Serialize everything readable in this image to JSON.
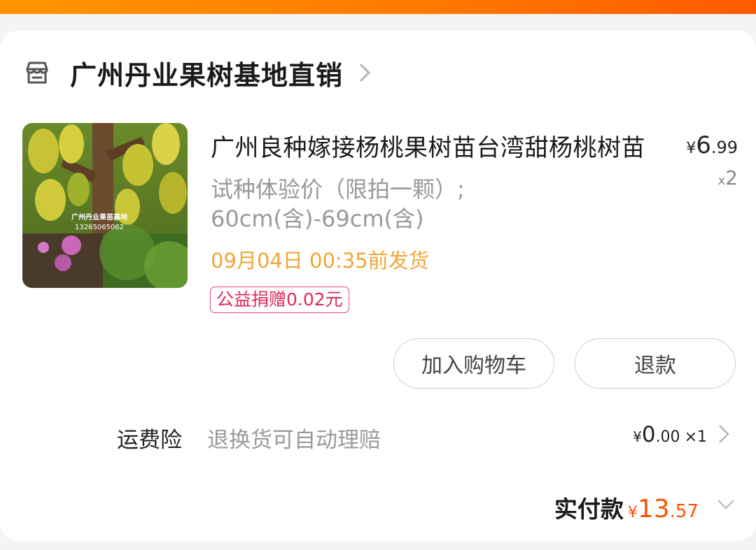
{
  "store": {
    "name": "广州丹业果树基地直销"
  },
  "item": {
    "title": "广州良种嫁接杨桃果树苗台湾甜杨桃树苗",
    "spec_line1": "试种体验价（限拍一颗）;",
    "spec_line2": "60cm(含)-69cm(含)",
    "price_currency": "¥",
    "price_int": "6",
    "price_dec": ".99",
    "qty_prefix": "x",
    "qty": "2",
    "delivery": "09月04日 00:35前发货",
    "donation": "公益捐赠0.02元",
    "image_caption_line1": "广州丹业果苗基地",
    "image_caption_line2": "13265065062"
  },
  "actions": {
    "add_to_cart": "加入购物车",
    "refund": "退款"
  },
  "insurance": {
    "label": "运费险",
    "desc": "退换货可自动理赔",
    "currency": "¥",
    "price_int": "0",
    "price_dec": ".00",
    "qty": "×1"
  },
  "total": {
    "label": "实付款",
    "currency": "¥",
    "int": "13",
    "dec": ".57"
  },
  "colors": {
    "accent_orange": "#ff5000",
    "delivery_text": "#f0a637",
    "donation_border": "#e8456f",
    "top_bar": "#ff7a00"
  }
}
